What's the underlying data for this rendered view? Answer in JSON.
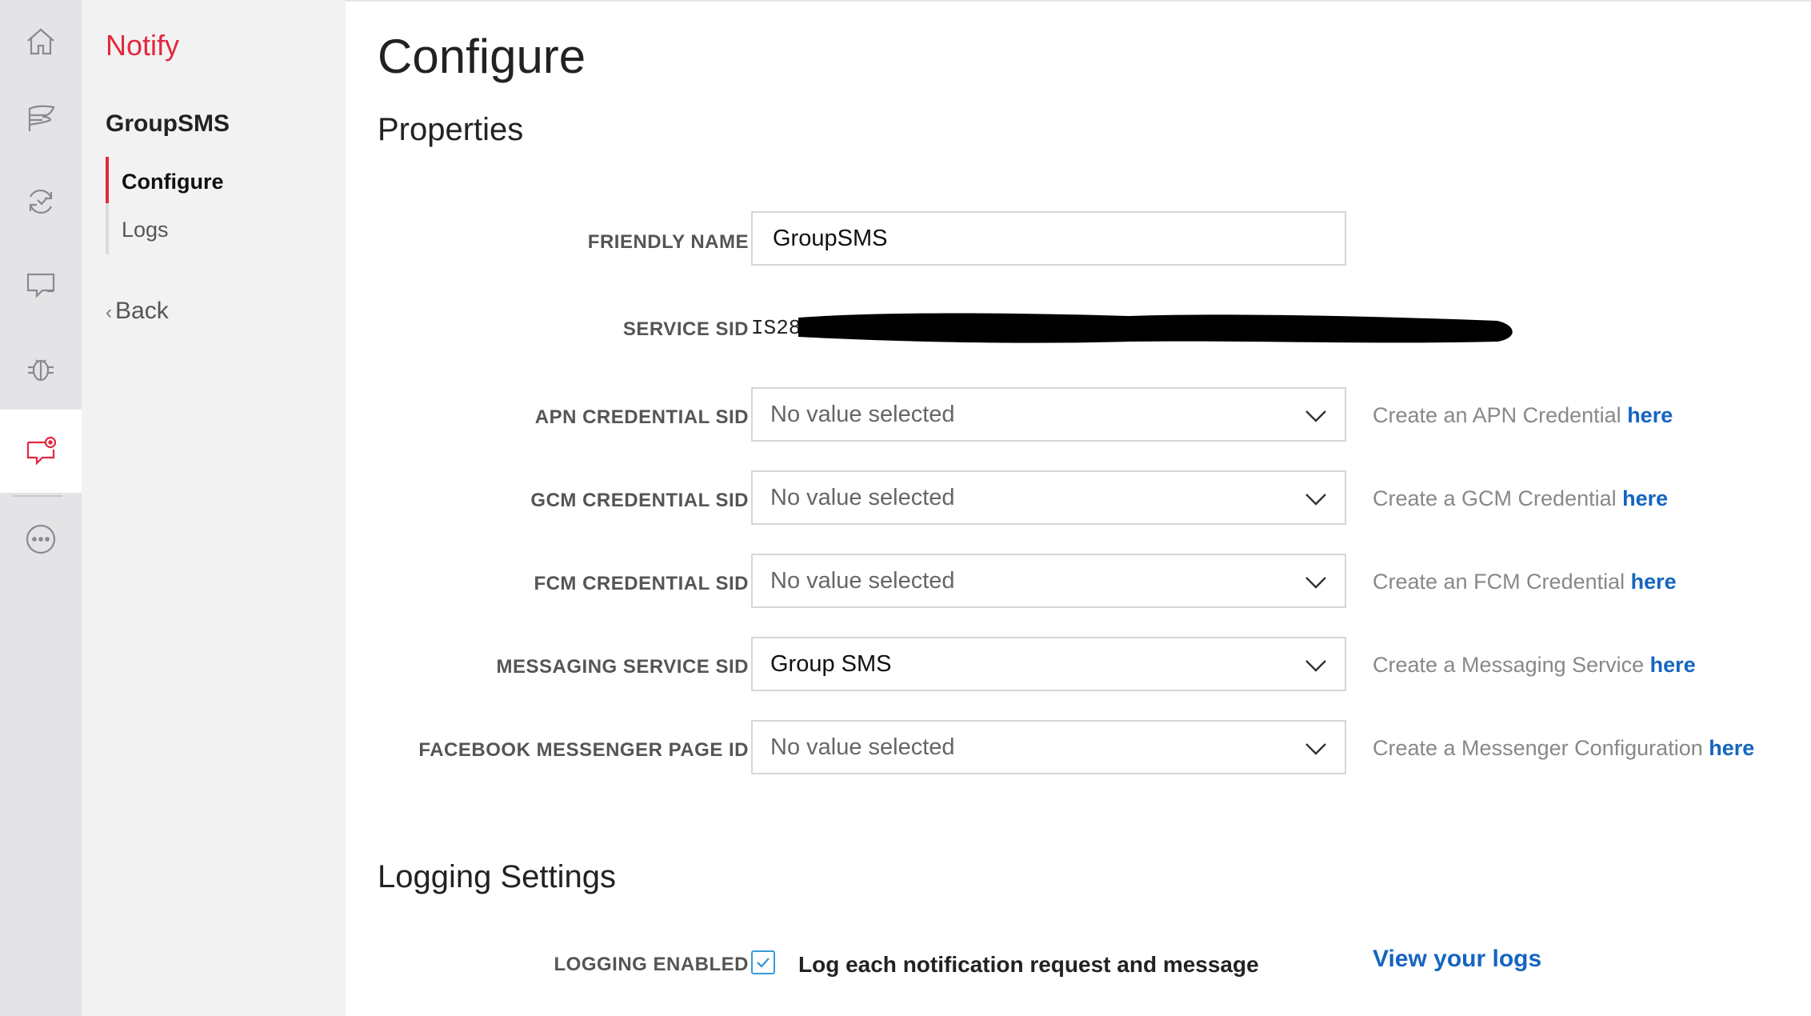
{
  "rail": {
    "items": [
      {
        "icon": "home-icon"
      },
      {
        "icon": "flag-icon"
      },
      {
        "icon": "sync-icon"
      },
      {
        "icon": "chat-icon"
      },
      {
        "icon": "bug-icon"
      },
      {
        "icon": "notify-chat-icon",
        "active": true
      },
      {
        "icon": "more-icon"
      }
    ],
    "accent": "#e2283f"
  },
  "subnav": {
    "product": "Notify",
    "service": "GroupSMS",
    "items": [
      {
        "label": "Configure",
        "active": true
      },
      {
        "label": "Logs",
        "active": false
      }
    ],
    "back": "Back"
  },
  "main": {
    "title": "Configure",
    "properties_title": "Properties",
    "friendly_name": {
      "label": "FRIENDLY NAME",
      "value": "GroupSMS"
    },
    "service_sid": {
      "label": "SERVICE SID",
      "value": "IS28"
    },
    "apn": {
      "label": "APN CREDENTIAL SID",
      "value": "No value selected",
      "hint": "Create an APN Credential ",
      "link": "here"
    },
    "gcm": {
      "label": "GCM CREDENTIAL SID",
      "value": "No value selected",
      "hint": "Create a GCM Credential ",
      "link": "here"
    },
    "fcm": {
      "label": "FCM CREDENTIAL SID",
      "value": "No value selected",
      "hint": "Create an FCM Credential ",
      "link": "here"
    },
    "messaging": {
      "label": "MESSAGING SERVICE SID",
      "value": "Group SMS",
      "hint": "Create a Messaging Service ",
      "link": "here"
    },
    "facebook": {
      "label": "FACEBOOK MESSENGER PAGE ID",
      "value": "No value selected",
      "hint": "Create a Messenger Configuration ",
      "link": "here"
    },
    "logging_title": "Logging Settings",
    "logging": {
      "label": "LOGGING ENABLED",
      "checked": true,
      "checkbox_label": "Log each notification request and message",
      "view_logs": "View your logs"
    }
  },
  "colors": {
    "link": "#1565c0",
    "accent": "#e2283f",
    "checkbox": "#3a9ad9"
  }
}
